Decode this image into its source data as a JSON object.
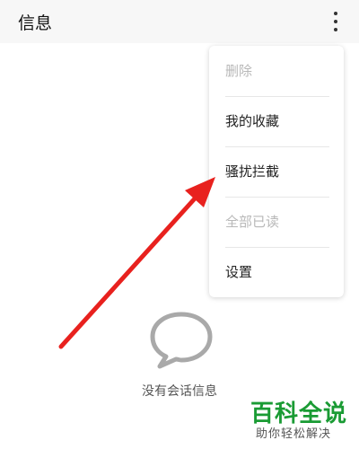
{
  "header": {
    "title": "信息"
  },
  "menu": {
    "items": [
      {
        "label": "删除",
        "enabled": false
      },
      {
        "label": "我的收藏",
        "enabled": true
      },
      {
        "label": "骚扰拦截",
        "enabled": true
      },
      {
        "label": "全部已读",
        "enabled": false
      },
      {
        "label": "设置",
        "enabled": true
      }
    ]
  },
  "empty_state": {
    "message": "没有会话信息",
    "icon": "speech-bubble-icon"
  },
  "annotation": {
    "type": "red-arrow",
    "color": "#e8211e",
    "points_to": "骚扰拦截"
  },
  "watermark": {
    "title": "百科全说",
    "subtitle": "助你轻松解决",
    "color": "#1a9b34"
  }
}
